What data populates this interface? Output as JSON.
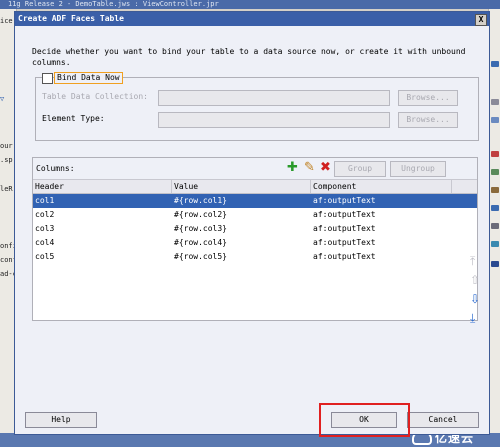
{
  "ide": {
    "title": "11g Release 2 - DemoTable.jws : ViewController.jpr",
    "left_fragments": [
      "ice",
      "▽",
      "our",
      ".sp",
      "leR",
      "onfi",
      "conf",
      "ad-c"
    ],
    "watermark": "亿速云"
  },
  "dialog": {
    "title": "Create ADF Faces Table",
    "close_label": "X",
    "description": "Decide whether you want to bind your table to a data source now, or create it with unbound columns.",
    "bind_data_now_label": "Bind Data Now",
    "bind_data_now_checked": false,
    "table_data_collection_label": "Table Data Collection:",
    "table_data_collection_value": "",
    "element_type_label": "Element Type:",
    "element_type_value": "",
    "browse_label": "Browse...",
    "columns_label": "Columns:",
    "group_label": "Group",
    "ungroup_label": "Ungroup",
    "headers": [
      "Header",
      "Value",
      "Component"
    ],
    "rows": [
      {
        "header": "col1",
        "value": "#{row.col1}",
        "component": "af:outputText",
        "selected": true
      },
      {
        "header": "col2",
        "value": "#{row.col2}",
        "component": "af:outputText",
        "selected": false
      },
      {
        "header": "col3",
        "value": "#{row.col3}",
        "component": "af:outputText",
        "selected": false
      },
      {
        "header": "col4",
        "value": "#{row.col4}",
        "component": "af:outputText",
        "selected": false
      },
      {
        "header": "col5",
        "value": "#{row.col5}",
        "component": "af:outputText",
        "selected": false
      }
    ],
    "help_label": "Help",
    "ok_label": "OK",
    "cancel_label": "Cancel"
  },
  "colors": {
    "title_bar": "#3a5fa8",
    "selection": "#3162b3",
    "highlight": "#e02020",
    "add_icon": "#2a9a2a",
    "delete_icon": "#d02020"
  }
}
